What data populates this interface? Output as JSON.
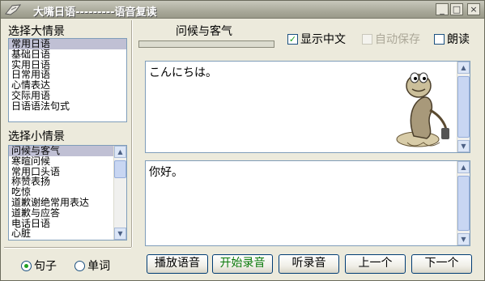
{
  "window": {
    "title": "大嘴日语---------语音复读",
    "buttons": {
      "minimize": "_",
      "maximize": "□",
      "close": "×"
    }
  },
  "big_scenes": {
    "label": "选择大情景",
    "items": [
      "常用日语",
      "基础日语",
      "实用日语",
      "日常用语",
      "心情表达",
      "交际用语",
      "日语语法句式"
    ],
    "selected_index": 0
  },
  "small_scenes": {
    "label": "选择小情景",
    "items": [
      "问候与客气",
      "寒暄问候",
      "常用口头语",
      "称赞表扬",
      "吃惊",
      "道歉谢绝常用表达",
      "道歉与应答",
      "电话日语",
      "心脏"
    ],
    "selected_index": 0
  },
  "mode": {
    "options": [
      {
        "label": "句子",
        "selected": true
      },
      {
        "label": "单词",
        "selected": false
      }
    ]
  },
  "scene_title": "问候与客气",
  "progress": {
    "value": 0
  },
  "options": {
    "show_chinese": {
      "label": "显示中文",
      "checked": true,
      "enabled": true
    },
    "auto_save": {
      "label": "自动保存",
      "checked": false,
      "enabled": false
    },
    "read_aloud": {
      "label": "朗读",
      "checked": false,
      "enabled": true
    }
  },
  "japanese_text": "こんにちは。",
  "chinese_text": "你好。",
  "controls": {
    "play": "播放语音",
    "record": "开始录音",
    "listen": "听录音",
    "prev": "上一个",
    "next": "下一个"
  },
  "colors": {
    "accent_green": "#21a121",
    "selection": "#c0c0d4",
    "window_bg": "#eceadc"
  }
}
